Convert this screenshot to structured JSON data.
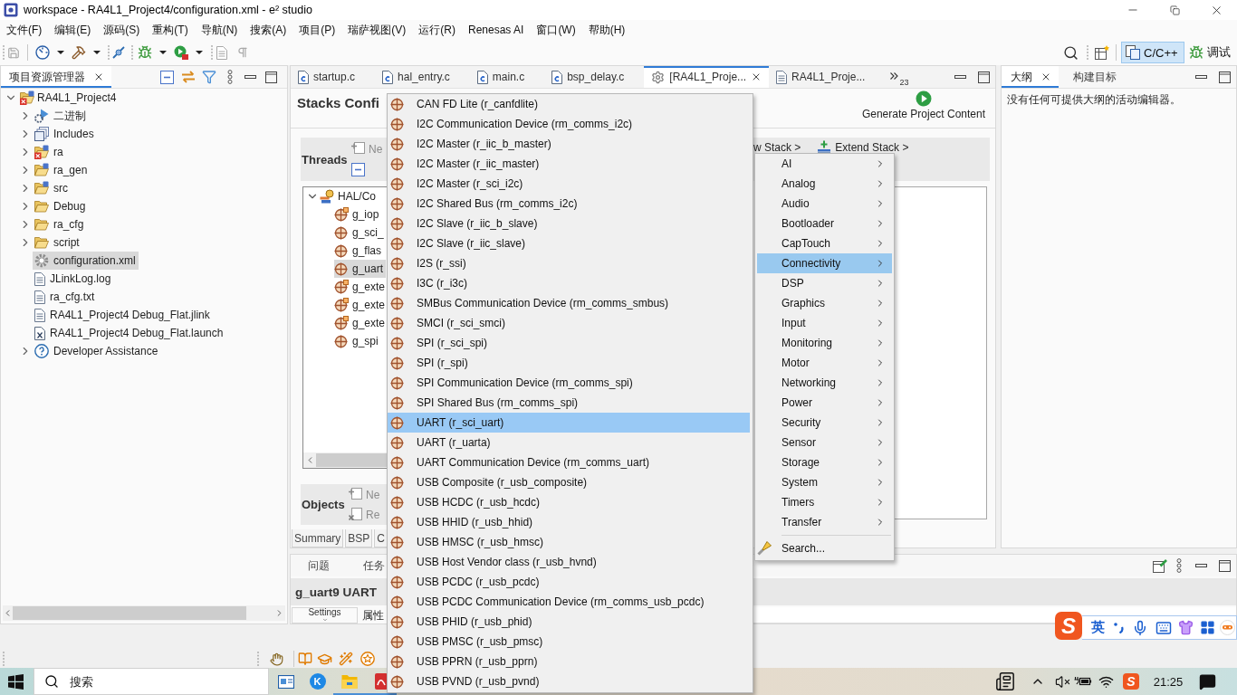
{
  "window": {
    "title": "workspace - RA4L1_Project4/configuration.xml - e² studio"
  },
  "menu_bar": [
    "文件(F)",
    "编辑(E)",
    "源码(S)",
    "重构(T)",
    "导航(N)",
    "搜索(A)",
    "项目(P)",
    "瑞萨视图(V)",
    "运行(R)",
    "Renesas AI",
    "窗口(W)",
    "帮助(H)"
  ],
  "perspectives": [
    {
      "label": "C/C++",
      "kind": "c",
      "selected": true
    },
    {
      "label": "调试",
      "kind": "debug",
      "selected": false
    }
  ],
  "project_explorer": {
    "tab": "项目资源管理器",
    "tree": [
      {
        "label": "RA4L1_Project4",
        "kind": "project",
        "error": true,
        "selected": false,
        "expanded": true,
        "children": [
          {
            "label": "二进制",
            "kind": "binaries",
            "error": false,
            "selected": false,
            "expanded": false
          },
          {
            "label": "Includes",
            "kind": "includes",
            "error": false,
            "selected": false,
            "expanded": false
          },
          {
            "label": "ra",
            "kind": "source-folder",
            "error": true,
            "selected": false,
            "expanded": false
          },
          {
            "label": "ra_gen",
            "kind": "source-folder",
            "error": false,
            "selected": false,
            "expanded": false
          },
          {
            "label": "src",
            "kind": "source-folder",
            "error": false,
            "selected": false,
            "expanded": false
          },
          {
            "label": "Debug",
            "kind": "folder",
            "error": false,
            "selected": false,
            "expanded": false
          },
          {
            "label": "ra_cfg",
            "kind": "folder",
            "error": false,
            "selected": false,
            "expanded": false
          },
          {
            "label": "script",
            "kind": "folder",
            "error": false,
            "selected": false,
            "expanded": false
          },
          {
            "label": "configuration.xml",
            "kind": "config-file",
            "error": false,
            "selected": true
          },
          {
            "label": "JLinkLog.log",
            "kind": "text-file",
            "error": false,
            "selected": false
          },
          {
            "label": "ra_cfg.txt",
            "kind": "text-file",
            "error": false,
            "selected": false
          },
          {
            "label": "RA4L1_Project4 Debug_Flat.jlink",
            "kind": "text-file",
            "error": false,
            "selected": false
          },
          {
            "label": "RA4L1_Project4 Debug_Flat.launch",
            "kind": "launch-file",
            "error": false,
            "selected": false
          },
          {
            "label": "Developer Assistance",
            "kind": "help",
            "error": false,
            "selected": false,
            "expanded": false
          }
        ]
      }
    ]
  },
  "editor": {
    "tabs": [
      {
        "label": "startup.c",
        "kind": "source",
        "selected": false
      },
      {
        "label": "hal_entry.c",
        "kind": "source",
        "selected": false
      },
      {
        "label": "main.c",
        "kind": "source",
        "selected": false
      },
      {
        "label": "bsp_delay.c",
        "kind": "source",
        "selected": false
      },
      {
        "label": "[RA4L1_Proje...",
        "kind": "config",
        "selected": true
      },
      {
        "label": "RA4L1_Proje...",
        "kind": "text",
        "selected": false
      }
    ],
    "overflow_count": "23",
    "stacks": {
      "title": "Stacks Confi",
      "generate": "Generate Project Content",
      "threads_label": "Threads",
      "thread_actions": [
        {
          "label": "Ne",
          "kind": "new",
          "disabled": true
        }
      ],
      "stack_actions": [
        {
          "label": "w Stack >",
          "kind": "new"
        },
        {
          "label": "Extend Stack >",
          "kind": "extend"
        }
      ],
      "thread_tree": {
        "label": "HAL/Co",
        "selected": false,
        "expanded": true,
        "children": [
          {
            "label": "g_iop",
            "kind": "module-badge",
            "selected": false
          },
          {
            "label": "g_sci_",
            "kind": "module",
            "selected": false
          },
          {
            "label": "g_flas",
            "kind": "module",
            "selected": false
          },
          {
            "label": "g_uart",
            "kind": "module",
            "selected": true
          },
          {
            "label": "g_exte",
            "kind": "module-badge",
            "selected": false
          },
          {
            "label": "g_exte",
            "kind": "module-badge",
            "selected": false
          },
          {
            "label": "g_exte",
            "kind": "module-badge",
            "selected": false
          },
          {
            "label": "g_spi",
            "kind": "module",
            "selected": false
          }
        ]
      },
      "objects_label": "Objects",
      "object_actions": [
        {
          "label": "Ne",
          "kind": "new",
          "disabled": true
        },
        {
          "label": "Re",
          "kind": "remove",
          "disabled": true
        }
      ]
    },
    "page_tabs": [
      {
        "label": "Summary",
        "selected": false
      },
      {
        "label": "BSP",
        "selected": false
      },
      {
        "label": "C",
        "selected": false
      }
    ]
  },
  "outline": {
    "tabs": [
      {
        "label": "大纲",
        "selected": true
      },
      {
        "label": "构建目标",
        "selected": false
      }
    ],
    "message": "没有任何可提供大纲的活动编辑器。"
  },
  "bottom_panel": {
    "tabs": [
      {
        "label": "问题",
        "selected": false
      },
      {
        "label": "任务",
        "selected": false
      }
    ],
    "title": "g_uart9 UART",
    "side_tab": "Settings",
    "column": "属性"
  },
  "component_menu": [
    {
      "label": "CAN FD Lite (r_canfdlite)",
      "selected": false
    },
    {
      "label": "I2C Communication Device (rm_comms_i2c)",
      "selected": false
    },
    {
      "label": "I2C Master (r_iic_b_master)",
      "selected": false
    },
    {
      "label": "I2C Master (r_iic_master)",
      "selected": false
    },
    {
      "label": "I2C Master (r_sci_i2c)",
      "selected": false
    },
    {
      "label": "I2C Shared Bus (rm_comms_i2c)",
      "selected": false
    },
    {
      "label": "I2C Slave (r_iic_b_slave)",
      "selected": false
    },
    {
      "label": "I2C Slave (r_iic_slave)",
      "selected": false
    },
    {
      "label": "I2S (r_ssi)",
      "selected": false
    },
    {
      "label": "I3C (r_i3c)",
      "selected": false
    },
    {
      "label": "SMBus Communication Device (rm_comms_smbus)",
      "selected": false
    },
    {
      "label": "SMCI (r_sci_smci)",
      "selected": false
    },
    {
      "label": "SPI (r_sci_spi)",
      "selected": false
    },
    {
      "label": "SPI (r_spi)",
      "selected": false
    },
    {
      "label": "SPI Communication Device (rm_comms_spi)",
      "selected": false
    },
    {
      "label": "SPI Shared Bus (rm_comms_spi)",
      "selected": false
    },
    {
      "label": "UART (r_sci_uart)",
      "selected": true
    },
    {
      "label": "UART (r_uarta)",
      "selected": false
    },
    {
      "label": "UART Communication Device (rm_comms_uart)",
      "selected": false
    },
    {
      "label": "USB Composite (r_usb_composite)",
      "selected": false
    },
    {
      "label": "USB HCDC (r_usb_hcdc)",
      "selected": false
    },
    {
      "label": "USB HHID (r_usb_hhid)",
      "selected": false
    },
    {
      "label": "USB HMSC (r_usb_hmsc)",
      "selected": false
    },
    {
      "label": "USB Host Vendor class (r_usb_hvnd)",
      "selected": false
    },
    {
      "label": "USB PCDC (r_usb_pcdc)",
      "selected": false
    },
    {
      "label": "USB PCDC Communication Device (rm_comms_usb_pcdc)",
      "selected": false
    },
    {
      "label": "USB PHID (r_usb_phid)",
      "selected": false
    },
    {
      "label": "USB PMSC (r_usb_pmsc)",
      "selected": false
    },
    {
      "label": "USB PPRN (r_usb_pprn)",
      "selected": false
    },
    {
      "label": "USB PVND (r_usb_pvnd)",
      "selected": false
    }
  ],
  "category_menu": {
    "items": [
      {
        "label": "AI",
        "selected": false
      },
      {
        "label": "Analog",
        "selected": false
      },
      {
        "label": "Audio",
        "selected": false
      },
      {
        "label": "Bootloader",
        "selected": false
      },
      {
        "label": "CapTouch",
        "selected": false
      },
      {
        "label": "Connectivity",
        "selected": true
      },
      {
        "label": "DSP",
        "selected": false
      },
      {
        "label": "Graphics",
        "selected": false
      },
      {
        "label": "Input",
        "selected": false
      },
      {
        "label": "Monitoring",
        "selected": false
      },
      {
        "label": "Motor",
        "selected": false
      },
      {
        "label": "Networking",
        "selected": false
      },
      {
        "label": "Power",
        "selected": false
      },
      {
        "label": "Security",
        "selected": false
      },
      {
        "label": "Sensor",
        "selected": false
      },
      {
        "label": "Storage",
        "selected": false
      },
      {
        "label": "System",
        "selected": false
      },
      {
        "label": "Timers",
        "selected": false
      },
      {
        "label": "Transfer",
        "selected": false
      }
    ],
    "search": "Search..."
  },
  "ime_bar": {
    "logo": "S",
    "mode": "英"
  },
  "taskbar": {
    "search": {
      "placeholder": "搜索"
    },
    "apps": [
      {
        "kind": "window",
        "running": false
      },
      {
        "kind": "letter-logo",
        "label": "K",
        "running": false
      },
      {
        "kind": "folder",
        "running": true
      },
      {
        "kind": "document",
        "running": true
      }
    ],
    "tray_logo": "S",
    "clock": "21:25"
  }
}
